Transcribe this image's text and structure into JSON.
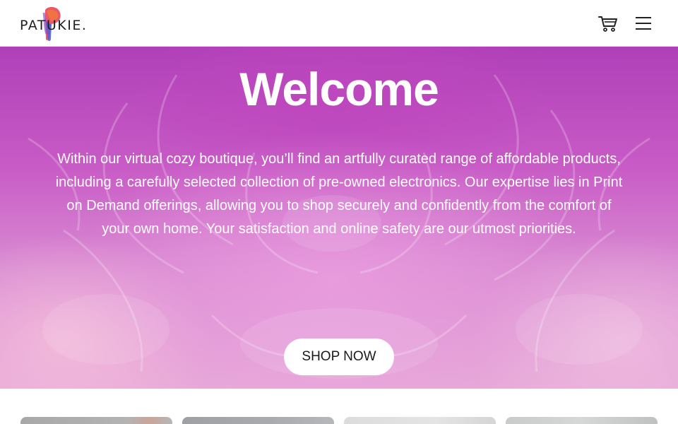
{
  "brand": {
    "name": "PATUKIE."
  },
  "header": {
    "cart_icon": "shopping-cart-icon",
    "menu_icon": "hamburger-menu-icon"
  },
  "hero": {
    "title": "Welcome",
    "text": "Within our virtual cozy boutique, you’ll find an artfully curated range of affordable products, including a carefully selected collection of pre-owned electronics. Our expertise lies in Print on Demand offerings, allowing you to shop securely and confidently from the comfort of your own home. Your satisfaction and online safety are our utmost priorities.",
    "cta_label": "SHOP NOW"
  },
  "colors": {
    "hero_accent": "#c04fc0",
    "button_bg": "#ffffff",
    "header_bg": "#ffffff"
  }
}
